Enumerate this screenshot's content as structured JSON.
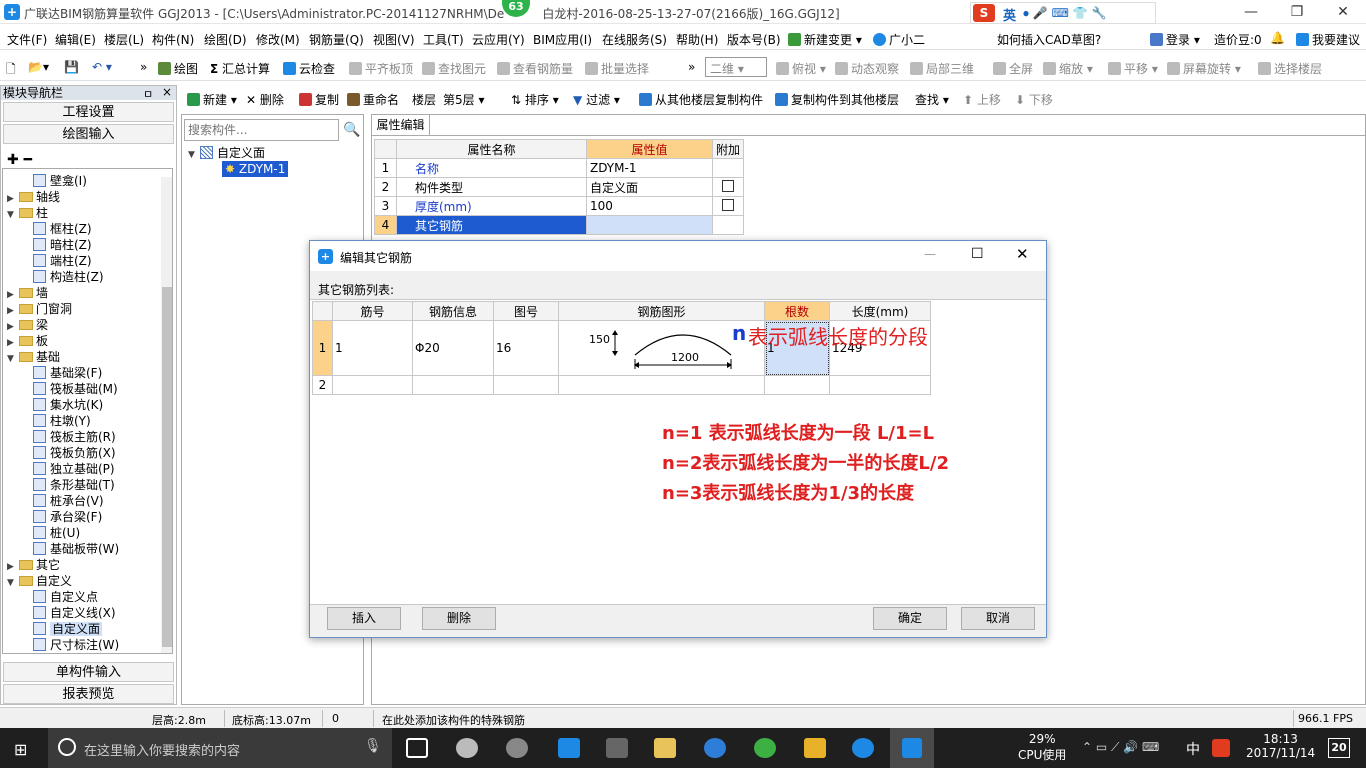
{
  "app": {
    "title": "广联达BIM钢筋算量软件 GGJ2013 - [C:\\Users\\Administrator.PC-20141127NRHM\\De",
    "title_suffix": "白龙村-2016-08-25-13-27-07(2166版)_16G.GGJ12]",
    "badge": "63",
    "ime_label": "英",
    "ime_logo": "S"
  },
  "menu": [
    "文件(F)",
    "编辑(E)",
    "楼层(L)",
    "构件(N)",
    "绘图(D)",
    "修改(M)",
    "钢筋量(Q)",
    "视图(V)",
    "工具(T)",
    "云应用(Y)",
    "BIM应用(I)",
    "在线服务(S)",
    "帮助(H)",
    "版本号(B)",
    "新建变更",
    "广小二"
  ],
  "menu_right": {
    "cad_hint": "如何插入CAD草图?",
    "login": "登录",
    "zaojiadou": "造价豆:0",
    "suggest": "我要建议"
  },
  "toolbar1": {
    "draw": "绘图",
    "sum": "汇总计算",
    "cloud_check": "云检查",
    "flat_slab": "平齐板顶",
    "find_elem": "查找图元",
    "view_rebar": "查看钢筋量",
    "batch_select": "批量选择",
    "view_mode": "二维",
    "top_view": "俯视",
    "dynamic": "动态观察",
    "local3d": "局部三维",
    "fullscreen": "全屏",
    "zoom": "缩放",
    "pan": "平移",
    "rotate": "屏幕旋转",
    "select_floor": "选择楼层"
  },
  "toolbar2": {
    "new": "新建",
    "delete": "删除",
    "copy": "复制",
    "rename": "重命名",
    "floor_label": "楼层",
    "floor_value": "第5层",
    "sort": "排序",
    "filter": "过滤",
    "copy_from": "从其他楼层复制构件",
    "copy_to": "复制构件到其他楼层",
    "find": "查找",
    "up": "上移",
    "down": "下移"
  },
  "nav": {
    "header": "模块导航栏",
    "pin": "ㅁ",
    "close": "×",
    "btn_project": "工程设置",
    "btn_draw": "绘图输入",
    "btn_single": "单构件输入",
    "btn_report": "报表预览",
    "tree": [
      {
        "label": "壁龛(I)",
        "indent": 2,
        "type": "leaf"
      },
      {
        "label": "轴线",
        "indent": 0,
        "type": "folder",
        "state": "closed"
      },
      {
        "label": "柱",
        "indent": 0,
        "type": "folder",
        "state": "open"
      },
      {
        "label": "框柱(Z)",
        "indent": 2,
        "type": "leaf"
      },
      {
        "label": "暗柱(Z)",
        "indent": 2,
        "type": "leaf"
      },
      {
        "label": "端柱(Z)",
        "indent": 2,
        "type": "leaf"
      },
      {
        "label": "构造柱(Z)",
        "indent": 2,
        "type": "leaf"
      },
      {
        "label": "墙",
        "indent": 0,
        "type": "folder",
        "state": "closed"
      },
      {
        "label": "门窗洞",
        "indent": 0,
        "type": "folder",
        "state": "closed"
      },
      {
        "label": "梁",
        "indent": 0,
        "type": "folder",
        "state": "closed"
      },
      {
        "label": "板",
        "indent": 0,
        "type": "folder",
        "state": "closed"
      },
      {
        "label": "基础",
        "indent": 0,
        "type": "folder",
        "state": "open"
      },
      {
        "label": "基础梁(F)",
        "indent": 2,
        "type": "leaf"
      },
      {
        "label": "筏板基础(M)",
        "indent": 2,
        "type": "leaf"
      },
      {
        "label": "集水坑(K)",
        "indent": 2,
        "type": "leaf"
      },
      {
        "label": "柱墩(Y)",
        "indent": 2,
        "type": "leaf"
      },
      {
        "label": "筏板主筋(R)",
        "indent": 2,
        "type": "leaf"
      },
      {
        "label": "筏板负筋(X)",
        "indent": 2,
        "type": "leaf"
      },
      {
        "label": "独立基础(P)",
        "indent": 2,
        "type": "leaf"
      },
      {
        "label": "条形基础(T)",
        "indent": 2,
        "type": "leaf"
      },
      {
        "label": "桩承台(V)",
        "indent": 2,
        "type": "leaf"
      },
      {
        "label": "承台梁(F)",
        "indent": 2,
        "type": "leaf"
      },
      {
        "label": "桩(U)",
        "indent": 2,
        "type": "leaf"
      },
      {
        "label": "基础板带(W)",
        "indent": 2,
        "type": "leaf"
      },
      {
        "label": "其它",
        "indent": 0,
        "type": "folder",
        "state": "closed"
      },
      {
        "label": "自定义",
        "indent": 0,
        "type": "folder",
        "state": "open"
      },
      {
        "label": "自定义点",
        "indent": 2,
        "type": "leaf"
      },
      {
        "label": "自定义线(X)",
        "indent": 2,
        "type": "leaf"
      },
      {
        "label": "自定义面",
        "indent": 2,
        "type": "leaf",
        "selected": true
      },
      {
        "label": "尺寸标注(W)",
        "indent": 2,
        "type": "leaf"
      }
    ]
  },
  "midpanel": {
    "search_placeholder": "搜索构件...",
    "root": "自定义面",
    "child": "ZDYM-1"
  },
  "props": {
    "tab": "属性编辑",
    "headers": [
      "属性名称",
      "属性值",
      "附加"
    ],
    "rows": [
      {
        "no": "1",
        "name": "名称",
        "value": "ZDYM-1",
        "check": false
      },
      {
        "no": "2",
        "name": "构件类型",
        "value": "自定义面",
        "check": true
      },
      {
        "no": "3",
        "name": "厚度(mm)",
        "value": "100",
        "check": true
      },
      {
        "no": "4",
        "name": "其它钢筋",
        "value": "",
        "check": false
      }
    ]
  },
  "dialog": {
    "title": "编辑其它钢筋",
    "list_label": "其它钢筋列表:",
    "headers": [
      "筋号",
      "钢筋信息",
      "图号",
      "钢筋图形",
      "根数",
      "长度(mm)"
    ],
    "rows": [
      {
        "no": "1",
        "bar": "1",
        "info": "Φ20",
        "fig": "16",
        "count": "1",
        "length": "1249",
        "dim_h": "150",
        "dim_w": "1200"
      },
      {
        "no": "2",
        "bar": "",
        "info": "",
        "fig": "",
        "count": "",
        "length": ""
      }
    ],
    "btn_insert": "插入",
    "btn_delete": "删除",
    "btn_ok": "确定",
    "btn_cancel": "取消",
    "annotation_n": "n",
    "annotation_main": "表示弧线长度的分段",
    "note1": "n=1 表示弧线长度为一段 L/1=L",
    "note2": "n=2表示弧线长度为一半的长度L/2",
    "note3": "n=3表示弧线长度为1/3的长度"
  },
  "status": {
    "floor_height": "层高:2.8m",
    "base_height": "底标高:13.07m",
    "zero": "0",
    "hint": "在此处添加该构件的特殊钢筋",
    "fps": "966.1 FPS"
  },
  "taskbar": {
    "search_placeholder": "在这里输入你要搜索的内容",
    "cpu_pct": "29%",
    "cpu_label": "CPU使用",
    "lang": "中",
    "time": "18:13",
    "date": "2017/11/14",
    "notif": "20"
  },
  "colors": {
    "accent": "#1e88e5",
    "annotation_red": "#e02020",
    "annotation_blue": "#1a3ccc",
    "header_orange": "#fcd28a",
    "row_num_orange": "#fcd28a",
    "selected_blue": "#cfe0f8"
  }
}
